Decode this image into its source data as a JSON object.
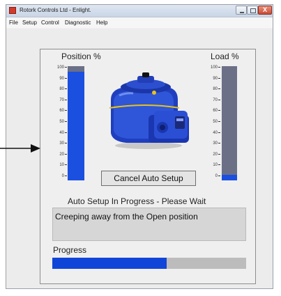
{
  "window": {
    "title": "Rotork Controls Ltd - Enlight.",
    "close_glyph": "X"
  },
  "menu": [
    "File",
    "Setup",
    "Control",
    "Diagnostic",
    "Help"
  ],
  "position_gauge": {
    "label": "Position %",
    "ticks": [
      "100",
      "90",
      "80",
      "70",
      "60",
      "50",
      "40",
      "30",
      "20",
      "10",
      "0"
    ],
    "value_percent": 95
  },
  "load_gauge": {
    "label": "Load %",
    "ticks": [
      "100",
      "90",
      "80",
      "70",
      "60",
      "50",
      "40",
      "30",
      "20",
      "10",
      "0"
    ],
    "value_percent": 5
  },
  "cancel_button": {
    "label": "Cancel Auto Setup"
  },
  "status": {
    "heading": "Auto Setup In Progress - Please Wait",
    "message": "Creeping away from the Open position"
  },
  "progress": {
    "label": "Progress",
    "value_fraction": 0.59
  },
  "colors": {
    "bar_fill": "#1a4fe0",
    "bar_track": "#6b7086",
    "actuator": "#1f3fbf"
  }
}
